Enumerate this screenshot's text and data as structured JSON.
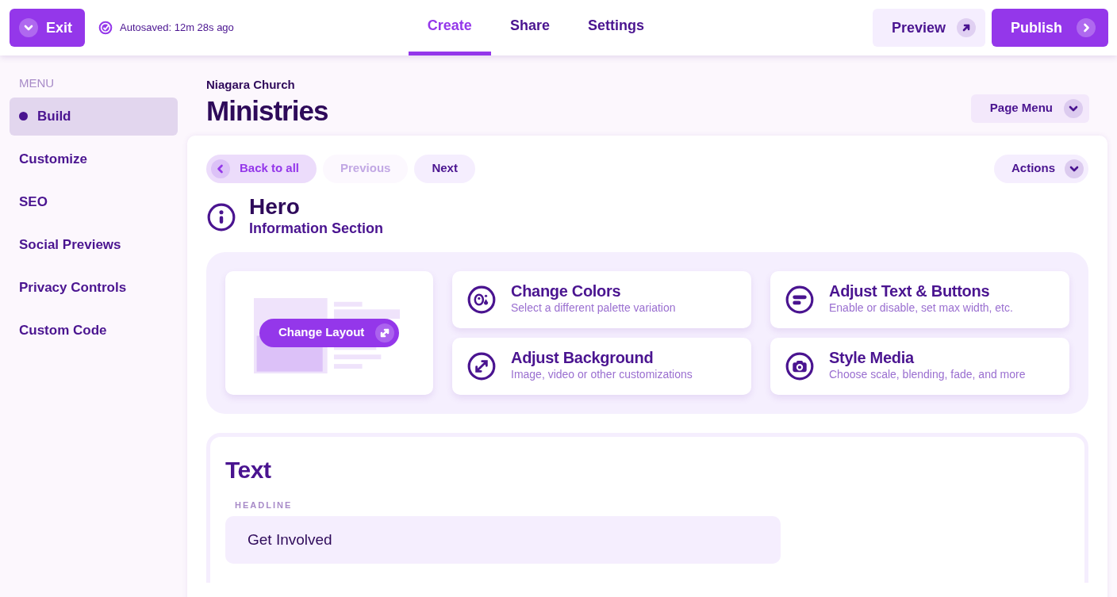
{
  "header": {
    "exit_label": "Exit",
    "autosave": "Autosaved: 12m 28s ago",
    "tabs": [
      {
        "label": "Create",
        "selected": true
      },
      {
        "label": "Share",
        "selected": false
      },
      {
        "label": "Settings",
        "selected": false
      }
    ],
    "preview_label": "Preview",
    "publish_label": "Publish"
  },
  "sidebar": {
    "heading": "MENU",
    "items": [
      {
        "label": "Build",
        "selected": true
      },
      {
        "label": "Customize",
        "selected": false
      },
      {
        "label": "SEO",
        "selected": false
      },
      {
        "label": "Social Previews",
        "selected": false
      },
      {
        "label": "Privacy Controls",
        "selected": false
      },
      {
        "label": "Custom Code",
        "selected": false
      }
    ]
  },
  "page": {
    "site": "Niagara Church",
    "title": "Ministries",
    "page_menu": "Page Menu"
  },
  "section": {
    "nav": [
      {
        "label": "Back to all",
        "kind": "back",
        "disabled": false
      },
      {
        "label": "Previous",
        "kind": "plain",
        "disabled": true
      },
      {
        "label": "Next",
        "kind": "plain",
        "disabled": false
      }
    ],
    "actions_label": "Actions",
    "title": "Hero",
    "subtitle": "Information Section",
    "layout_button": "Change Layout",
    "options": [
      {
        "kind": "palette",
        "title": "Change Colors",
        "description": "Select a different palette variation"
      },
      {
        "kind": "text",
        "title": "Adjust Text & Buttons",
        "description": "Enable or disable, set max width, etc."
      },
      {
        "kind": "expand",
        "title": "Adjust Background",
        "description": "Image, video or other customizations"
      },
      {
        "kind": "camera",
        "title": "Style Media",
        "description": "Choose scale, blending, fade, and more"
      }
    ]
  },
  "text_panel": {
    "title": "Text",
    "fields": [
      {
        "label": "HEADLINE",
        "value": "Get Involved"
      }
    ]
  }
}
